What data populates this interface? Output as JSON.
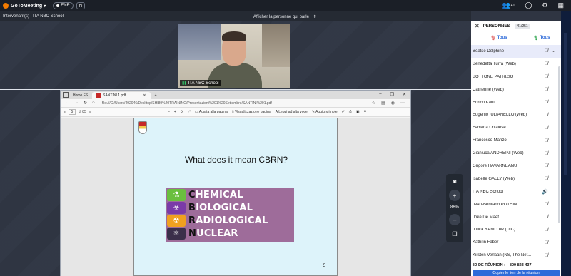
{
  "app": {
    "name": "GoToMeeting",
    "record_label": "ENR"
  },
  "topbar": {
    "participants_count": "41"
  },
  "subbar": {
    "speakers_text": "Intervenant(s) : ITA NBC School",
    "show_speaker_label": "Afficher la personne qui parle"
  },
  "webcam": {
    "name": "ITA NBC School"
  },
  "browser": {
    "tabs": [
      {
        "label": "Home FS"
      },
      {
        "label": "SANTINI 1.pdf"
      }
    ],
    "url": "file:///C:/Users/492046/Desktop/SHI89%20TRAINING/Presentazioni%201%20Settembre/SANTINI%201.pdf",
    "page_number": "5",
    "page_total": "di 85",
    "toolbar": {
      "fit_label": "Adatta alla pagina",
      "view_label": "Visualizzazione pagina",
      "read_label": "Leggi ad alta voce",
      "notes_label": "Aggiungi note"
    }
  },
  "slide": {
    "title": "What does it mean CBRN?",
    "words": [
      {
        "first": "C",
        "rest": "HEMICAL"
      },
      {
        "first": "B",
        "rest": "IOLOGICAL"
      },
      {
        "first": "R",
        "rest": "ADIOLOGICAL"
      },
      {
        "first": "N",
        "rest": "UCLEAR"
      }
    ],
    "page_label": "5",
    "icon_colors": [
      "#6abf3f",
      "#7a3aa8",
      "#f0a020",
      "#3b2f4a"
    ]
  },
  "zoom": {
    "percent": "86%"
  },
  "panel": {
    "title": "PERSONNES",
    "count": "41/251",
    "filter_left": "Tous",
    "filter_right": "Tous",
    "people": [
      {
        "name": "Beatse Delphine",
        "selected": true,
        "mic": "muted"
      },
      {
        "name": "Benedetta Turrà  (Web)",
        "mic": "muted"
      },
      {
        "name": "BOTTONE PATRIZIO",
        "mic": "muted"
      },
      {
        "name": "Catherine  (Web)",
        "mic": "muted"
      },
      {
        "name": "Enrico Kahl",
        "mic": "muted"
      },
      {
        "name": "Eugenio IULIANELLO  (Web)",
        "mic": "muted"
      },
      {
        "name": "Fabiana Chiaiese",
        "mic": "muted"
      },
      {
        "name": "Francesco Manzo",
        "mic": "muted"
      },
      {
        "name": "Gianluca ANDREINI  (Web)",
        "mic": "muted"
      },
      {
        "name": "Grigore HAVARNEANU",
        "mic": "muted"
      },
      {
        "name": "Isabelle GALLY  (Web)",
        "mic": "muted"
      },
      {
        "name": "ITA NBC School",
        "mic": "speaking"
      },
      {
        "name": "Jean-Bertrand POTHIN",
        "mic": "muted"
      },
      {
        "name": "Joke De Maet",
        "mic": "muted"
      },
      {
        "name": "Julika RAMLOW (UIC)",
        "mic": "muted"
      },
      {
        "name": "Kathrin Faber",
        "mic": "muted"
      },
      {
        "name": "Kirsten Verlaan (NS, The Net...",
        "mic": "muted"
      }
    ],
    "meeting_id_label": "ID DE RÉUNION :",
    "meeting_id": "809 823 437",
    "copy_link_label": "Copier le lien de la réunion"
  },
  "icons": {
    "mic_muted": "🎙̸",
    "mic_on": "🔊"
  }
}
